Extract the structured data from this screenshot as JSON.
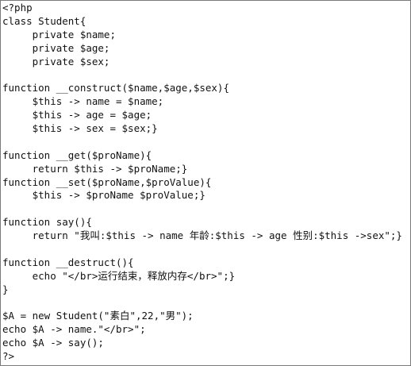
{
  "editor": {
    "language": "php",
    "lines": [
      "<?php",
      "class Student{",
      "     private $name;",
      "     private $age;",
      "     private $sex;",
      "",
      "function __construct($name,$age,$sex){",
      "     $this -> name = $name;",
      "     $this -> age = $age;",
      "     $this -> sex = $sex;}",
      "",
      "function __get($proName){",
      "     return $this -> $proName;}",
      "function __set($proName,$proValue){",
      "     $this -> $proName $proValue;}",
      "",
      "function say(){",
      "     return \"我叫:$this -> name 年龄:$this -> age 性别:$this ->sex\";}",
      "",
      "function __destruct(){",
      "     echo \"</br>运行结束，释放内存</br>\";}",
      "}",
      "",
      "$A = new Student(\"素白\",22,\"男\");",
      "echo $A -> name.\"</br>\";",
      "echo $A -> say();",
      "?>"
    ]
  }
}
